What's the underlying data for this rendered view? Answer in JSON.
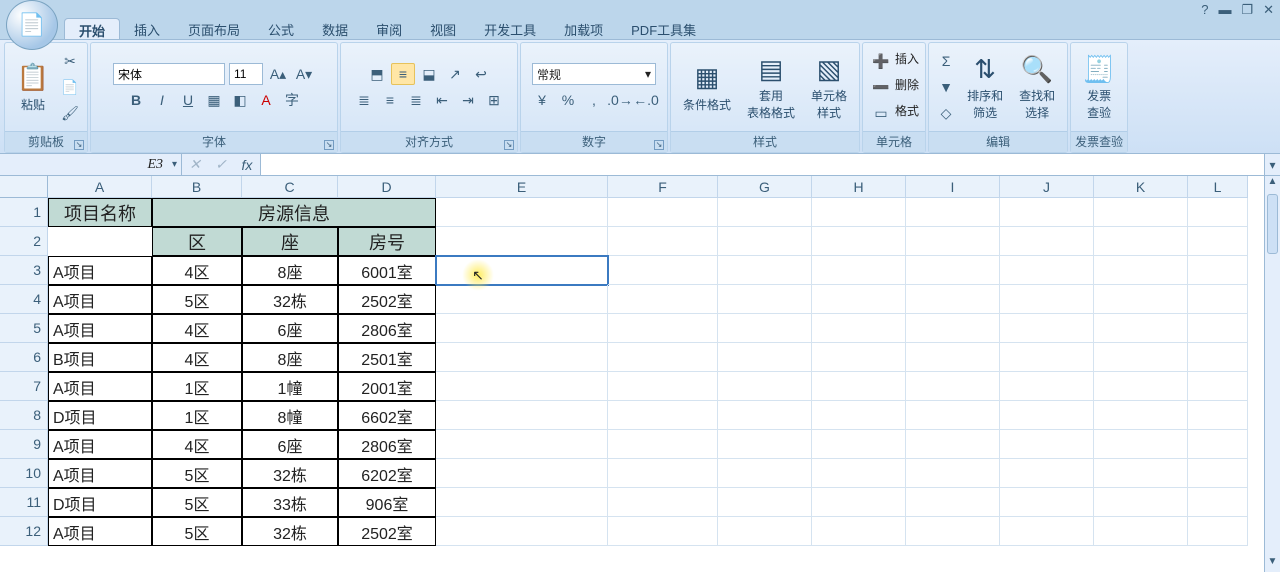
{
  "window": {
    "help_icon": "?"
  },
  "tabs": [
    "开始",
    "插入",
    "页面布局",
    "公式",
    "数据",
    "审阅",
    "视图",
    "开发工具",
    "加载项",
    "PDF工具集"
  ],
  "active_tab": 0,
  "ribbon": {
    "clipboard": {
      "label": "剪贴板",
      "paste": "粘贴"
    },
    "font": {
      "label": "字体",
      "name": "宋体",
      "size": "11",
      "buttons_row1": [
        "A↑",
        "A↓"
      ],
      "buttons_row2": [
        "B",
        "I",
        "U"
      ]
    },
    "align": {
      "label": "对齐方式"
    },
    "number": {
      "label": "数字",
      "format": "常规"
    },
    "styles": {
      "label": "样式",
      "cond": "条件格式",
      "table": "套用\n表格格式",
      "cell": "单元格\n样式"
    },
    "cells": {
      "label": "单元格",
      "insert": "插入",
      "delete": "删除",
      "format": "格式"
    },
    "editing": {
      "label": "编辑",
      "sort": "排序和\n筛选",
      "find": "查找和\n选择"
    },
    "invoice": {
      "label": "发票查验",
      "btn": "发票\n查验"
    }
  },
  "namebox": "E3",
  "columns": [
    "A",
    "B",
    "C",
    "D",
    "E",
    "F",
    "G",
    "H",
    "I",
    "J",
    "K",
    "L"
  ],
  "rows": [
    "1",
    "2",
    "3",
    "4",
    "5",
    "6",
    "7",
    "8",
    "9",
    "10",
    "11",
    "12"
  ],
  "headers": {
    "project": "项目名称",
    "housing": "房源信息",
    "zone": "区",
    "block": "座",
    "room": "房号"
  },
  "data": [
    [
      "A项目",
      "4区",
      "8座",
      "6001室"
    ],
    [
      "A项目",
      "5区",
      "32栋",
      "2502室"
    ],
    [
      "A项目",
      "4区",
      "6座",
      "2806室"
    ],
    [
      "B项目",
      "4区",
      "8座",
      "2501室"
    ],
    [
      "A项目",
      "1区",
      "1幢",
      "2001室"
    ],
    [
      "D项目",
      "1区",
      "8幢",
      "6602室"
    ],
    [
      "A项目",
      "4区",
      "6座",
      "2806室"
    ],
    [
      "A项目",
      "5区",
      "32栋",
      "6202室"
    ],
    [
      "D项目",
      "5区",
      "33栋",
      "906室"
    ],
    [
      "A项目",
      "5区",
      "32栋",
      "2502室"
    ]
  ]
}
